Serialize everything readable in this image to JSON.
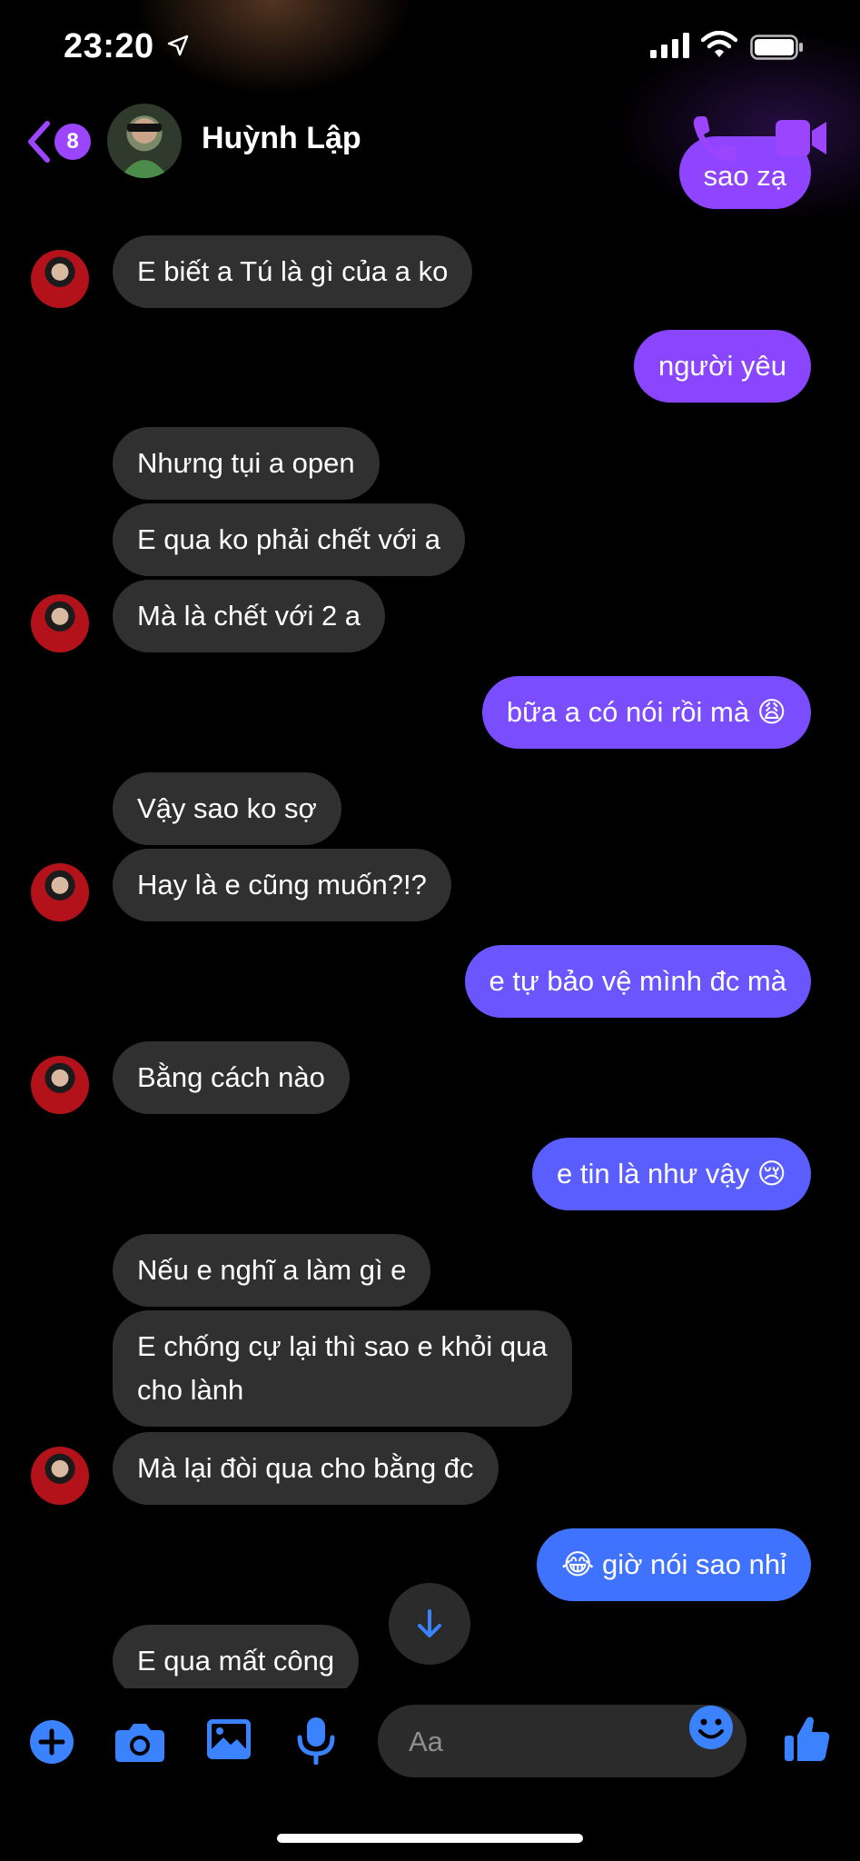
{
  "status_bar": {
    "time": "23:20",
    "signal_icon": "cellular-signal-icon",
    "wifi_icon": "wifi-icon",
    "battery_icon": "battery-icon"
  },
  "header": {
    "back_badge": "8",
    "contact_name": "Huỳnh Lập"
  },
  "colors": {
    "accent": "#9b45ff",
    "incoming_bubble": "#303030",
    "outgoing_top": "#8f44ff",
    "outgoing_bottom": "#3f73ff"
  },
  "messages": [
    {
      "from": "me",
      "text": "sao zạ"
    },
    {
      "from": "them",
      "text": "E biết a Tú là gì của a ko"
    },
    {
      "from": "me",
      "text": "người yêu"
    },
    {
      "from": "them",
      "text": "Nhưng tụi a open"
    },
    {
      "from": "them",
      "text": "E qua ko phải chết với a"
    },
    {
      "from": "them",
      "text": "Mà là chết với 2 a"
    },
    {
      "from": "me",
      "text": "bữa a có nói rồi mà 😩"
    },
    {
      "from": "them",
      "text": "Vậy sao ko sợ"
    },
    {
      "from": "them",
      "text": "Hay là e cũng muốn?!?"
    },
    {
      "from": "me",
      "text": "e tự bảo vệ mình đc mà"
    },
    {
      "from": "them",
      "text": "Bằng cách nào"
    },
    {
      "from": "me",
      "text": "e tin là như vậy 😢"
    },
    {
      "from": "them",
      "text": "Nếu e nghĩ a làm gì e"
    },
    {
      "from": "them",
      "text": "E chống cự lại thì sao e khỏi qua\ncho lành"
    },
    {
      "from": "them",
      "text": "Mà lại đòi qua cho bằng đc"
    },
    {
      "from": "me",
      "text": "😂 giờ nói sao nhỉ"
    },
    {
      "from": "them",
      "text": "E qua mất công"
    }
  ],
  "composer": {
    "placeholder": "Aa"
  }
}
